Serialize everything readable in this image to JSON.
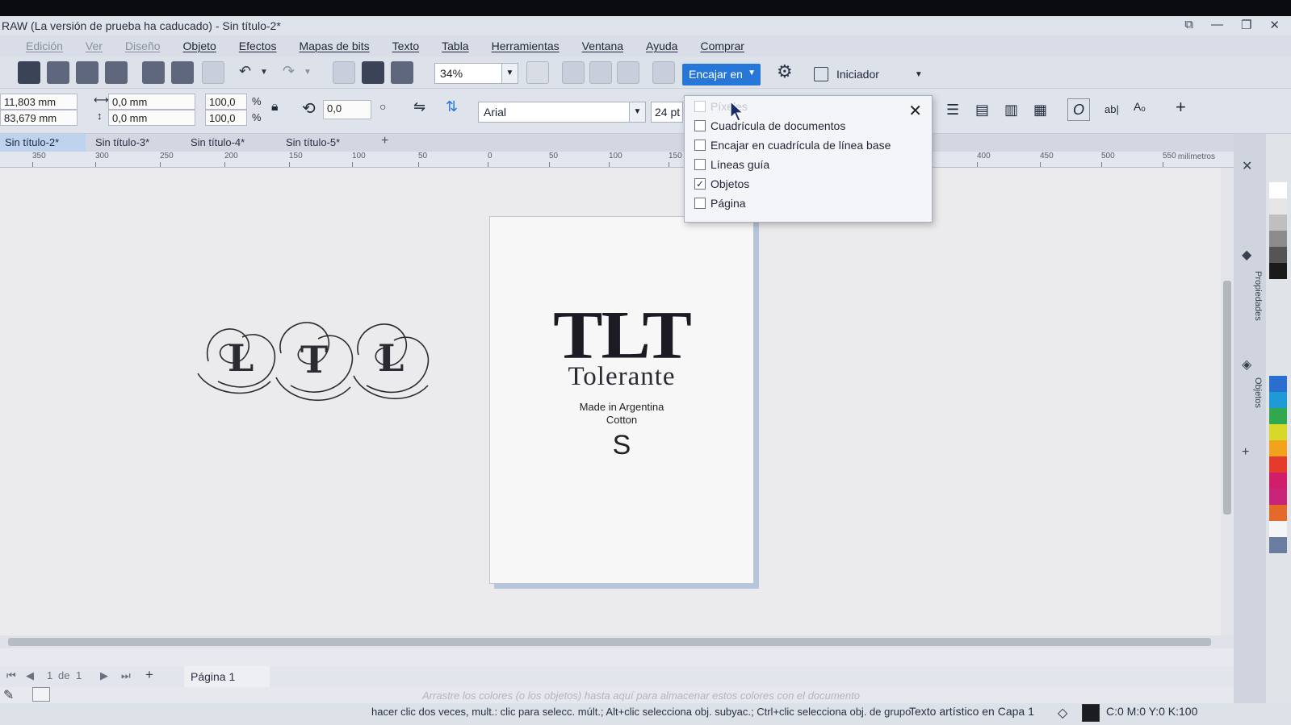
{
  "window": {
    "title": "RAW (La versión de prueba ha caducado) - Sin título-2*",
    "controls": [
      "⧉",
      "—",
      "❐",
      "✕"
    ]
  },
  "menu": {
    "items": [
      {
        "label": "Edición",
        "dim": true
      },
      {
        "label": "Ver",
        "dim": true
      },
      {
        "label": "Diseño",
        "dim": true
      },
      {
        "label": "Objeto",
        "dim": false
      },
      {
        "label": "Efectos",
        "dim": false
      },
      {
        "label": "Mapas de bits",
        "dim": false
      },
      {
        "label": "Texto",
        "dim": false
      },
      {
        "label": "Tabla",
        "dim": false
      },
      {
        "label": "Herramientas",
        "dim": false
      },
      {
        "label": "Ventana",
        "dim": false
      },
      {
        "label": "Ayuda",
        "dim": false
      },
      {
        "label": "Comprar",
        "dim": false
      }
    ]
  },
  "toolbar": {
    "zoom": "34%",
    "snap_label": "Encajar en",
    "launcher_label": "Iniciador"
  },
  "propbar": {
    "pos_x": "11,803 mm",
    "pos_y": "83,679 mm",
    "size_w": "0,0 mm",
    "size_h": "0,0 mm",
    "scale_w": "100,0",
    "scale_h": "100,0",
    "percent": "%",
    "rotation": "0,0",
    "font_name": "Arial",
    "font_size": "24 pt"
  },
  "tabs": [
    {
      "label": "Sin título-2*",
      "active": true
    },
    {
      "label": "Sin título-3*",
      "active": false
    },
    {
      "label": "Sin título-4*",
      "active": false
    },
    {
      "label": "Sin título-5*",
      "active": false
    }
  ],
  "ruler": {
    "ticks": [
      "350",
      "300",
      "250",
      "200",
      "150",
      "100",
      "50",
      "0",
      "50",
      "100",
      "150",
      "400",
      "450",
      "500",
      "550"
    ],
    "unit": "milímetros"
  },
  "snap_menu": {
    "items": [
      {
        "label": "Píxeles",
        "checked": false,
        "disabled": true
      },
      {
        "label": "Cuadrícula de documentos",
        "checked": false,
        "disabled": false
      },
      {
        "label": "Encajar en cuadrícula de línea base",
        "checked": false,
        "disabled": false
      },
      {
        "label": "Líneas guía",
        "checked": false,
        "disabled": false
      },
      {
        "label": "Objetos",
        "checked": true,
        "disabled": false
      },
      {
        "label": "Página",
        "checked": false,
        "disabled": false
      }
    ]
  },
  "document": {
    "brand": "TLT",
    "brand_name": "Tolerante",
    "origin": "Made in Argentina",
    "material": "Cotton",
    "size": "S"
  },
  "docker": {
    "labels": [
      "Propiedades",
      "Objetos"
    ]
  },
  "page_nav": {
    "current": "1",
    "of": "de",
    "total": "1",
    "page_tab": "Página 1"
  },
  "palette_hint": "Arrastre los colores (o los objetos) hasta aquí para almacenar estos colores con el documento",
  "status": {
    "hint": "hacer clic dos veces, mult.: clic para selecc. múlt.; Alt+clic selecciona obj. subyac.; Ctrl+clic selecciona obj. de grupo",
    "layer": "Texto artístico en Capa 1",
    "color": "C:0 M:0 Y:0 K:100"
  },
  "colors": {
    "accent": "#2777d9",
    "palette": [
      "#ffffff",
      "#e6e6e6",
      "#bfbfbf",
      "#8c8c8c",
      "#555555",
      "#1a1a1a",
      "#2a6fd0",
      "#1e9ad6",
      "#2fa84f",
      "#d8d82a",
      "#f2a21c",
      "#e53b2a",
      "#d01e6b",
      "#c8247a",
      "#e36a2a",
      "#f5f5f5",
      "#6a7da0"
    ]
  }
}
